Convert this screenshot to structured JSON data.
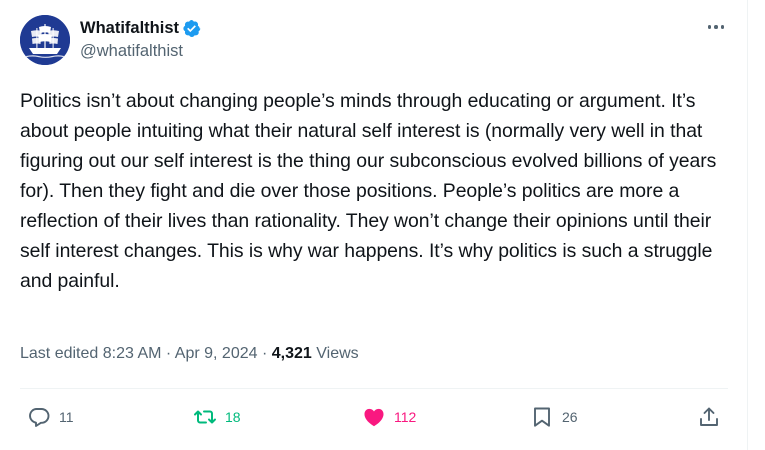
{
  "author": {
    "display_name": "Whatifalthist",
    "handle": "@whatifalthist",
    "avatar_icon": "sailing-ship-icon",
    "verified_icon": "verified-badge-icon"
  },
  "tweet": {
    "text": "Politics isn’t about changing people’s minds through educating or argument. It’s about people intuiting what their natural self interest is (normally very well in that figuring out our self interest is the thing our subconscious evolved billions of years for). Then they fight and die over those positions. People’s politics are more a reflection of their lives than rationality. They won’t change their opinions until their self interest changes. This is why war happens. It’s why politics is such a struggle and painful.",
    "meta": {
      "edited_prefix": "Last edited",
      "time": "8:23 AM",
      "separator": "·",
      "date": "Apr 9, 2024",
      "views_count": "4,321",
      "views_label": "Views"
    }
  },
  "actions": {
    "reply": {
      "icon": "reply-icon",
      "count": "11"
    },
    "retweet": {
      "icon": "retweet-icon",
      "count": "18"
    },
    "like": {
      "icon": "heart-icon",
      "count": "112"
    },
    "bookmark": {
      "icon": "bookmark-icon",
      "count": "26"
    },
    "share": {
      "icon": "share-icon"
    }
  },
  "colors": {
    "text": "#0f1419",
    "secondary": "#536471",
    "retweet_active": "#00ba7c",
    "like_active": "#f91880",
    "verified": "#1d9bf0",
    "avatar_bg": "#1f3a93"
  }
}
